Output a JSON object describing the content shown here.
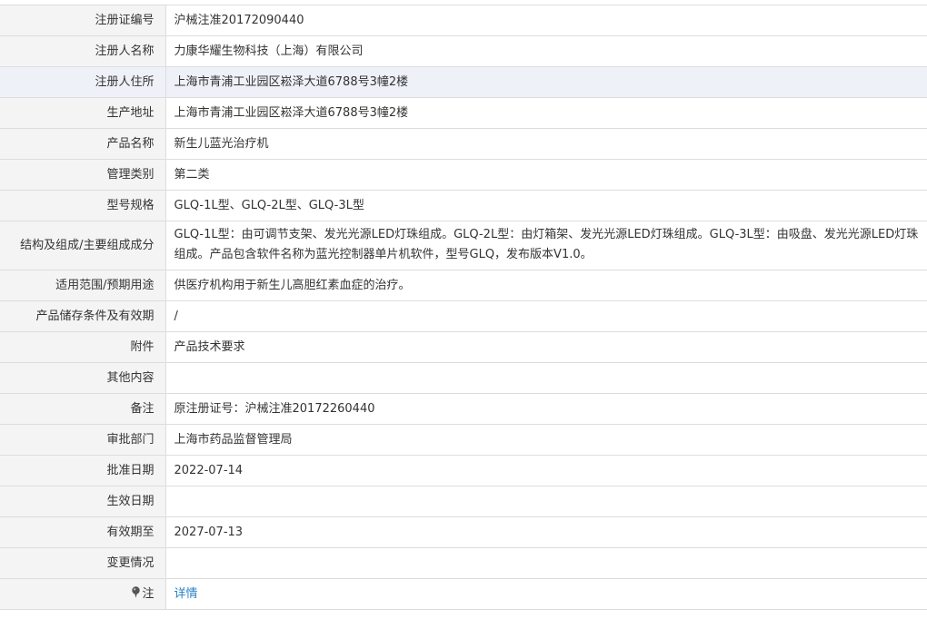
{
  "rows": [
    {
      "label": "注册证编号",
      "value": "沪械注准20172090440"
    },
    {
      "label": "注册人名称",
      "value": "力康华耀生物科技（上海）有限公司"
    },
    {
      "label": "注册人住所",
      "value": "上海市青浦工业园区崧泽大道6788号3幢2楼"
    },
    {
      "label": "生产地址",
      "value": "上海市青浦工业园区崧泽大道6788号3幢2楼"
    },
    {
      "label": "产品名称",
      "value": "新生儿蓝光治疗机"
    },
    {
      "label": "管理类别",
      "value": "第二类"
    },
    {
      "label": "型号规格",
      "value": "GLQ-1L型、GLQ-2L型、GLQ-3L型"
    },
    {
      "label": "结构及组成/主要组成成分",
      "value": "GLQ-1L型：由可调节支架、发光光源LED灯珠组成。GLQ-2L型：由灯箱架、发光光源LED灯珠组成。GLQ-3L型：由吸盘、发光光源LED灯珠组成。产品包含软件名称为蓝光控制器单片机软件，型号GLQ，发布版本V1.0。"
    },
    {
      "label": "适用范围/预期用途",
      "value": "供医疗机构用于新生儿高胆红素血症的治疗。"
    },
    {
      "label": "产品储存条件及有效期",
      "value": "/"
    },
    {
      "label": "附件",
      "value": "产品技术要求"
    },
    {
      "label": "其他内容",
      "value": ""
    },
    {
      "label": "备注",
      "value": "原注册证号：沪械注准20172260440"
    },
    {
      "label": "审批部门",
      "value": "上海市药品监督管理局"
    },
    {
      "label": "批准日期",
      "value": "2022-07-14"
    },
    {
      "label": "生效日期",
      "value": ""
    },
    {
      "label": "有效期至",
      "value": "2027-07-13"
    },
    {
      "label": "变更情况",
      "value": ""
    },
    {
      "label": "注",
      "value": "详情",
      "icon": "pin-icon"
    }
  ],
  "colors": {
    "label_bg": "#f4f4f4",
    "highlight_bg": "#eef1f8",
    "border": "#dddddd",
    "link": "#2a7fc6",
    "text": "#333333"
  }
}
